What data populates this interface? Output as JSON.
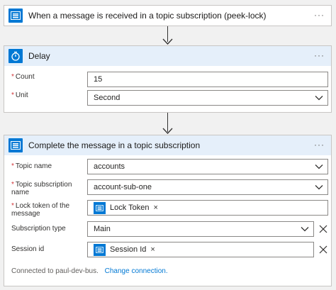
{
  "trigger": {
    "title": "When a message is received in a topic subscription (peek-lock)",
    "icon": "service-bus-icon",
    "menu": "···"
  },
  "delay": {
    "title": "Delay",
    "icon": "timer-icon",
    "menu": "···",
    "count_label": "Count",
    "count_value": "15",
    "unit_label": "Unit",
    "unit_value": "Second"
  },
  "complete": {
    "title": "Complete the message in a topic subscription",
    "icon": "service-bus-icon",
    "menu": "···",
    "topic_label": "Topic name",
    "topic_value": "accounts",
    "sub_label": "Topic subscription name",
    "sub_value": "account-sub-one",
    "lock_label": "Lock token of the message",
    "lock_token": "Lock Token",
    "subtype_label": "Subscription type",
    "subtype_value": "Main",
    "session_label": "Session id",
    "session_token": "Session Id",
    "token_remove": "×",
    "connected_text": "Connected to paul-dev-bus.",
    "change_link": "Change connection."
  },
  "colors": {
    "accent": "#0078d4",
    "header_bg": "#e5effa",
    "required": "#d13438"
  }
}
